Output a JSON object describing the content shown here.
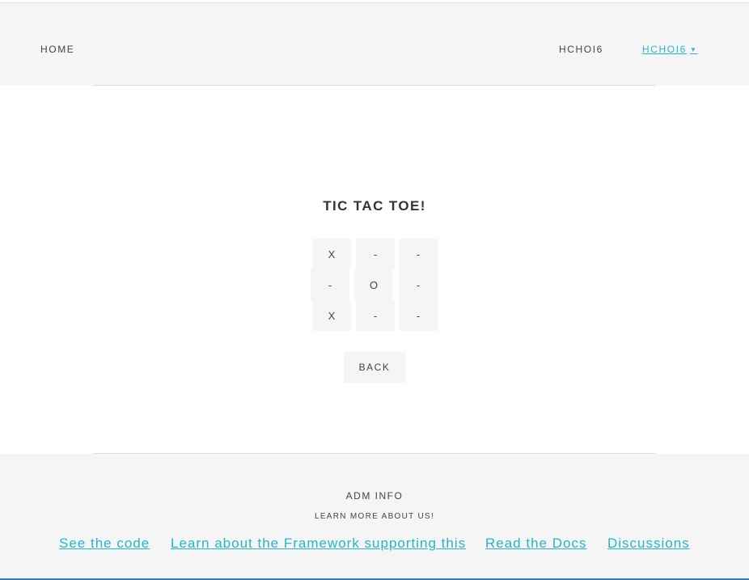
{
  "nav": {
    "home_label": "HOME",
    "user_label": "HCHOI6",
    "dropdown_label": "HCHOI6",
    "dropdown_caret": "▼"
  },
  "game": {
    "title": "TIC TAC TOE!",
    "board": [
      [
        "X",
        "-",
        "-"
      ],
      [
        "-",
        "O",
        "-"
      ],
      [
        "X",
        "-",
        "-"
      ]
    ],
    "back_label": "BACK"
  },
  "footer": {
    "title": "ADM INFO",
    "subtitle": "LEARN MORE ABOUT US!",
    "links": [
      "See the code",
      "Learn about the Framework supporting this",
      "Read the Docs",
      "Discussions"
    ]
  },
  "colors": {
    "accent": "#22b7c9",
    "panel_background": "#f5f5f5",
    "text": "#444444"
  }
}
